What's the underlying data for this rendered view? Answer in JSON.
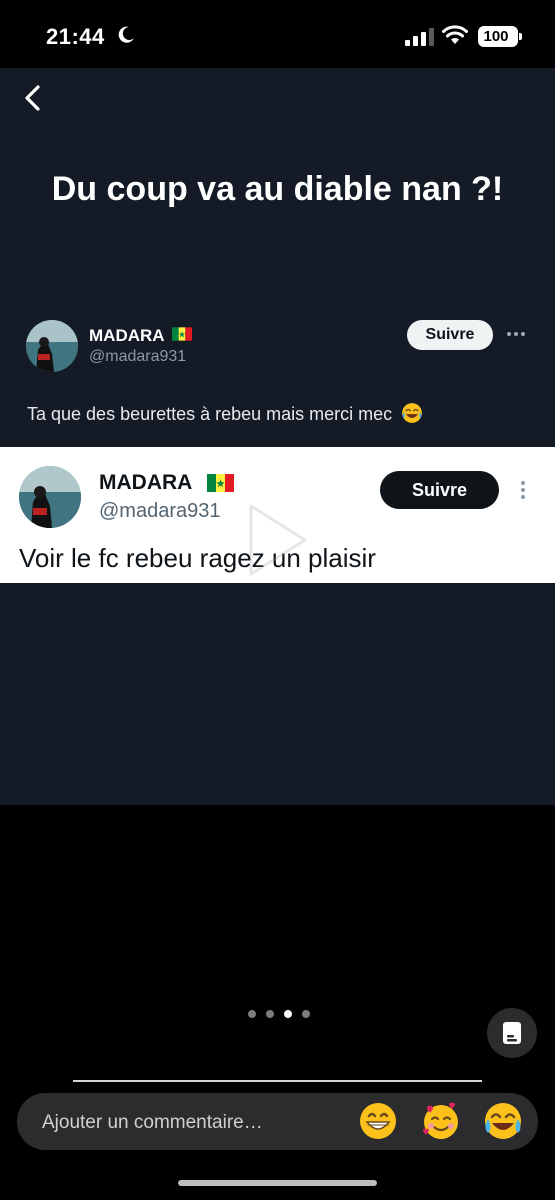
{
  "status_bar": {
    "time": "21:44",
    "battery": "100"
  },
  "post": {
    "title": "Du coup va au diable nan ?!"
  },
  "tweet_dark": {
    "name": "MADARA",
    "handle": "@madara931",
    "follow_label": "Suivre",
    "text": "Ta que des beurettes à rebeu mais merci mec"
  },
  "tweet_light": {
    "name": "MADARA",
    "handle": "@madara931",
    "follow_label": "Suivre",
    "text": "Voir le fc rebeu ragez un plaisir"
  },
  "pagination": {
    "total": 4,
    "active_index": 2
  },
  "comment": {
    "placeholder": "Ajouter un commentaire…"
  },
  "icons": {
    "back": "chevron-left-icon",
    "more_horizontal": "more-horizontal-icon",
    "more_vertical": "more-vertical-icon",
    "caption": "caption-icon",
    "emoji_1": "grinning-face-icon",
    "emoji_2": "smiling-face-with-hearts-icon",
    "emoji_3": "face-with-tears-of-joy-icon",
    "flag": "senegal-flag-icon"
  },
  "colors": {
    "media_background": "#141b27",
    "follow_dark_bg": "#0f1419",
    "follow_light_bg": "#eff3f4"
  }
}
